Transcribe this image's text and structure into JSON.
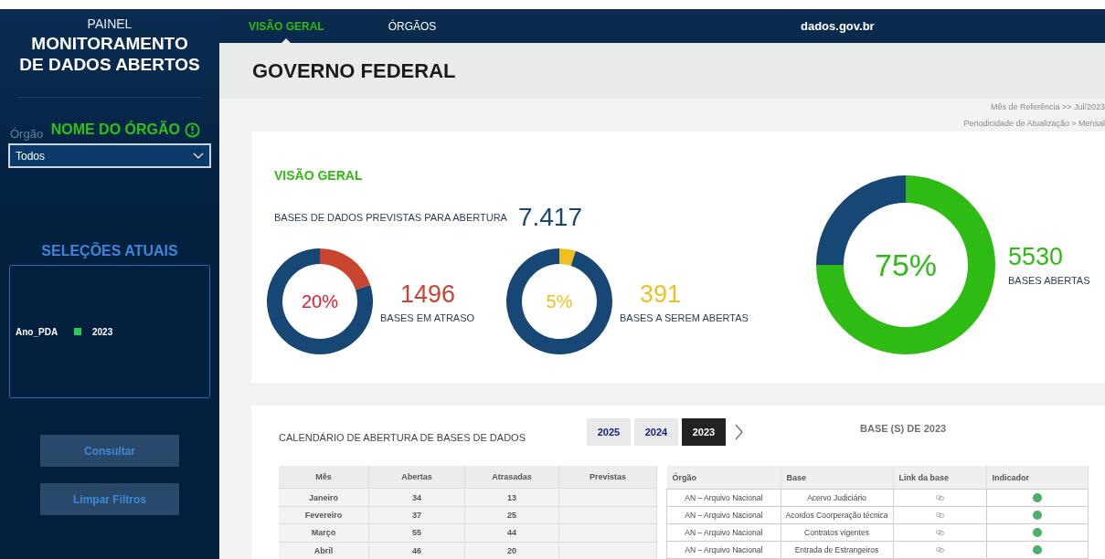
{
  "sidebar": {
    "subtitle": "PAINEL",
    "title_lines": [
      "MONITORAMENTO",
      "DE DADOS ABERTOS"
    ],
    "filter": {
      "ghost_label": "Órgão",
      "heading": "NOME DO ÓRGÃO",
      "value": "Todos"
    },
    "selections": {
      "heading": "SELEÇÕES ATUAIS",
      "items": [
        {
          "field": "Ano_PDA",
          "value": "2023",
          "color": "#22cc55"
        }
      ]
    },
    "buttons": [
      "Consultar",
      "Limpar Filtros"
    ]
  },
  "nav": {
    "tabs": [
      {
        "label": "VISÃO GERAL",
        "selected": true
      },
      {
        "label": "ÓRGÃOS",
        "selected": false
      }
    ],
    "site": "dados.gov.br"
  },
  "header": {
    "title": "GOVERNO FEDERAL",
    "meta": [
      "Mês de Referência >> Jul/2023",
      "Periodicidade de Atualização » Mensal"
    ]
  },
  "overview": {
    "heading": "VISÃO GERAL",
    "total_label": "BASES DE DADOS PREVISTAS PARA ABERTURA",
    "total": "7.417",
    "gauges": [
      {
        "kind": "small",
        "percent": "20%",
        "chart_data": {
          "type": "donut",
          "values": [
            20,
            80
          ]
        },
        "count": "1496",
        "label": "BASES EM ATRASO",
        "color": "#c8452f"
      },
      {
        "kind": "small",
        "percent": "5%",
        "chart_data": {
          "type": "donut",
          "values": [
            5,
            95
          ]
        },
        "count": "391",
        "label": "BASES A SEREM ABERTAS",
        "color": "#f0c020"
      },
      {
        "kind": "large",
        "percent": "75%",
        "chart_data": {
          "type": "donut",
          "values": [
            75,
            25
          ]
        },
        "count": "5530",
        "label": "BASES ABERTAS",
        "color": "#2dbb14"
      }
    ]
  },
  "calendar": {
    "heading": "CALENDÁRIO DE ABERTURA DE BASES DE DADOS",
    "years": [
      {
        "label": "2025",
        "selected": false
      },
      {
        "label": "2024",
        "selected": false
      },
      {
        "label": "2023",
        "selected": true
      }
    ],
    "bases_heading": "BASE (S) DE 2023",
    "months": {
      "columns": [
        "Mês",
        "Abertas",
        "Atrasadas",
        "Previstas"
      ],
      "rows": [
        {
          "month": "Janeiro",
          "abertas": "34",
          "atrasadas": "13"
        },
        {
          "month": "Fevereiro",
          "abertas": "37",
          "atrasadas": "25"
        },
        {
          "month": "Março",
          "abertas": "55",
          "atrasadas": "44"
        },
        {
          "month": "Abril",
          "abertas": "46",
          "atrasadas": "20"
        }
      ]
    },
    "bases": {
      "columns": [
        "Órgão",
        "Base",
        "Link da base",
        "Indicador"
      ],
      "rows": [
        {
          "orgao": "AN – Arquivo Nacional",
          "base": "Acervo Judiciário",
          "color": "#4caf6a"
        },
        {
          "orgao": "AN – Arquivo Nacional",
          "base": "Acordos Coorperação técnica",
          "color": "#4caf6a"
        },
        {
          "orgao": "AN – Arquivo Nacional",
          "base": "Contratos vigentes",
          "color": "#4caf6a"
        },
        {
          "orgao": "AN – Arquivo Nacional",
          "base": "Entrada de Estrangeiros",
          "color": "#4caf6a"
        }
      ]
    }
  }
}
